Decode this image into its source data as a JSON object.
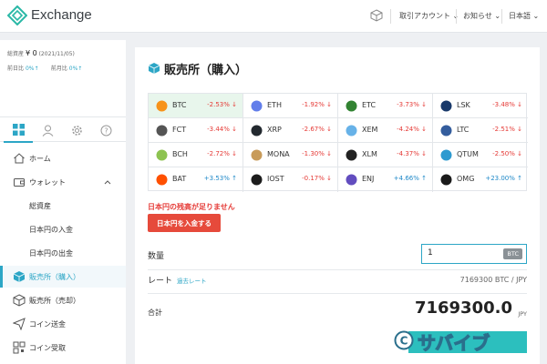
{
  "header": {
    "app_name": "Exchange",
    "account_menu": "取引アカウント ⌄",
    "notice_menu": "お知らせ ⌄",
    "language_menu": "日本語 ⌄"
  },
  "sidebar": {
    "balance": {
      "total_label": "総資産",
      "total_value": "¥ 0",
      "date": "(2021/11/05)",
      "prev_day_label": "前日比",
      "prev_day_value": "0%↑",
      "prev_month_label": "前月比",
      "prev_month_value": "0%↑"
    },
    "nav": [
      {
        "label": "ホーム",
        "icon": "home-icon"
      },
      {
        "label": "ウォレット",
        "icon": "wallet-icon"
      },
      {
        "label": "総資産",
        "sub": true
      },
      {
        "label": "日本円の入金",
        "sub": true
      },
      {
        "label": "日本円の出金",
        "sub": true
      },
      {
        "label": "販売所（購入）",
        "icon": "cube-icon",
        "active": true
      },
      {
        "label": "販売所（売却）",
        "icon": "cube-icon"
      },
      {
        "label": "コイン送金",
        "icon": "send-icon"
      },
      {
        "label": "コイン受取",
        "icon": "qr-icon"
      }
    ]
  },
  "main": {
    "title": "販売所（購入）",
    "coins": [
      {
        "symbol": "BTC",
        "change": "-2.53%",
        "dir": "down",
        "color": "#f7931a"
      },
      {
        "symbol": "ETH",
        "change": "-1.92%",
        "dir": "down",
        "color": "#627eea"
      },
      {
        "symbol": "ETC",
        "change": "-3.73%",
        "dir": "down",
        "color": "#328332"
      },
      {
        "symbol": "LSK",
        "change": "-3.48%",
        "dir": "down",
        "color": "#1a3a6b"
      },
      {
        "symbol": "FCT",
        "change": "-3.44%",
        "dir": "down",
        "color": "#555555"
      },
      {
        "symbol": "XRP",
        "change": "-2.67%",
        "dir": "down",
        "color": "#23292f"
      },
      {
        "symbol": "XEM",
        "change": "-4.24%",
        "dir": "down",
        "color": "#67b2e8"
      },
      {
        "symbol": "LTC",
        "change": "-2.51%",
        "dir": "down",
        "color": "#345d9d"
      },
      {
        "symbol": "BCH",
        "change": "-2.72%",
        "dir": "down",
        "color": "#8dc351"
      },
      {
        "symbol": "MONA",
        "change": "-1.30%",
        "dir": "down",
        "color": "#c89b5a"
      },
      {
        "symbol": "XLM",
        "change": "-4.37%",
        "dir": "down",
        "color": "#222222"
      },
      {
        "symbol": "QTUM",
        "change": "-2.50%",
        "dir": "down",
        "color": "#2e9ad0"
      },
      {
        "symbol": "BAT",
        "change": "+3.53%",
        "dir": "up",
        "color": "#ff5000"
      },
      {
        "symbol": "IOST",
        "change": "-0.17%",
        "dir": "down",
        "color": "#1c1c1c"
      },
      {
        "symbol": "ENJ",
        "change": "+4.66%",
        "dir": "up",
        "color": "#624dbf"
      },
      {
        "symbol": "OMG",
        "change": "+23.00%",
        "dir": "up",
        "color": "#1a1a1a"
      }
    ],
    "warning": "日本円の残高が足りません",
    "deposit_button": "日本円を入金する",
    "quantity_label": "数量",
    "quantity_value": "1",
    "quantity_unit": "BTC",
    "rate_label": "レート",
    "rate_link": "過去レート",
    "rate_value": "7169300 BTC / JPY",
    "total_label": "合計",
    "total_value": "7169300.0",
    "total_unit": "JPY",
    "accent": "#2ca6c6"
  },
  "watermark": {
    "text": "サバイブ"
  }
}
